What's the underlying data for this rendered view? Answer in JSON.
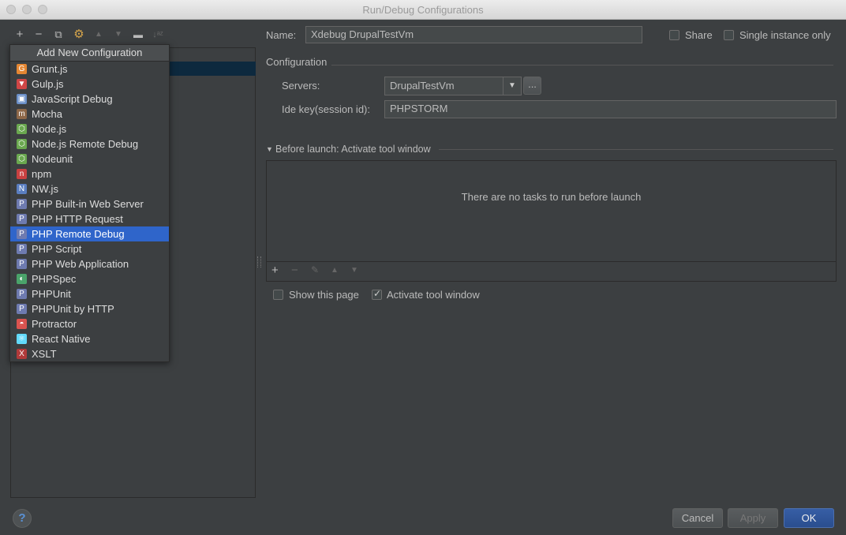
{
  "window": {
    "title": "Run/Debug Configurations"
  },
  "toolbar": {
    "add": "+",
    "remove": "−",
    "copy": "⧉",
    "edit_defaults": "⚙",
    "move_up": "▲",
    "move_down": "▼",
    "folder": "▬",
    "sort": "↓ᵃᶻ"
  },
  "popup": {
    "header": "Add New Configuration",
    "items": [
      {
        "label": "Grunt.js",
        "icon": "grunt-icon",
        "color": "#e48632"
      },
      {
        "label": "Gulp.js",
        "icon": "gulp-icon",
        "color": "#cf4646"
      },
      {
        "label": "JavaScript Debug",
        "icon": "js-debug-icon",
        "color": "#6a8fc8"
      },
      {
        "label": "Mocha",
        "icon": "mocha-icon",
        "color": "#8d6748"
      },
      {
        "label": "Node.js",
        "icon": "nodejs-icon",
        "color": "#6aa84f"
      },
      {
        "label": "Node.js Remote Debug",
        "icon": "nodejs-remote-icon",
        "color": "#6aa84f"
      },
      {
        "label": "Nodeunit",
        "icon": "nodeunit-icon",
        "color": "#6aa84f"
      },
      {
        "label": "npm",
        "icon": "npm-icon",
        "color": "#c94141"
      },
      {
        "label": "NW.js",
        "icon": "nwjs-icon",
        "color": "#5a7ec0"
      },
      {
        "label": "PHP Built-in Web Server",
        "icon": "php-icon",
        "color": "#6e7bb0"
      },
      {
        "label": "PHP HTTP Request",
        "icon": "php-icon",
        "color": "#6e7bb0"
      },
      {
        "label": "PHP Remote Debug",
        "icon": "php-icon",
        "color": "#6e7bb0",
        "selected": true
      },
      {
        "label": "PHP Script",
        "icon": "php-icon",
        "color": "#6e7bb0"
      },
      {
        "label": "PHP Web Application",
        "icon": "php-icon",
        "color": "#6e7bb0"
      },
      {
        "label": "PHPSpec",
        "icon": "phpspec-icon",
        "color": "#4aa36a"
      },
      {
        "label": "PHPUnit",
        "icon": "phpunit-icon",
        "color": "#6e7bb0"
      },
      {
        "label": "PHPUnit by HTTP",
        "icon": "phpunit-icon",
        "color": "#6e7bb0"
      },
      {
        "label": "Protractor",
        "icon": "protractor-icon",
        "color": "#d9534f"
      },
      {
        "label": "React Native",
        "icon": "react-icon",
        "color": "#61dafb"
      },
      {
        "label": "XSLT",
        "icon": "xslt-icon",
        "color": "#b03a3a"
      }
    ]
  },
  "form": {
    "name_label": "Name:",
    "name_value": "Xdebug DrupalTestVm",
    "share_label": "Share",
    "single_instance_label": "Single instance only",
    "configuration_label": "Configuration",
    "servers_label": "Servers:",
    "servers_value": "DrupalTestVm",
    "browse_label": "...",
    "ide_key_label": "Ide key(session id):",
    "ide_key_value": "PHPSTORM",
    "before_launch_label": "Before launch: Activate tool window",
    "no_tasks_text": "There are no tasks to run before launch",
    "show_page_label": "Show this page",
    "activate_tool_window_label": "Activate tool window"
  },
  "buttons": {
    "cancel": "Cancel",
    "apply": "Apply",
    "ok": "OK",
    "help": "?"
  },
  "colors": {
    "accent": "#2f65ca",
    "background": "#3c3f41"
  }
}
